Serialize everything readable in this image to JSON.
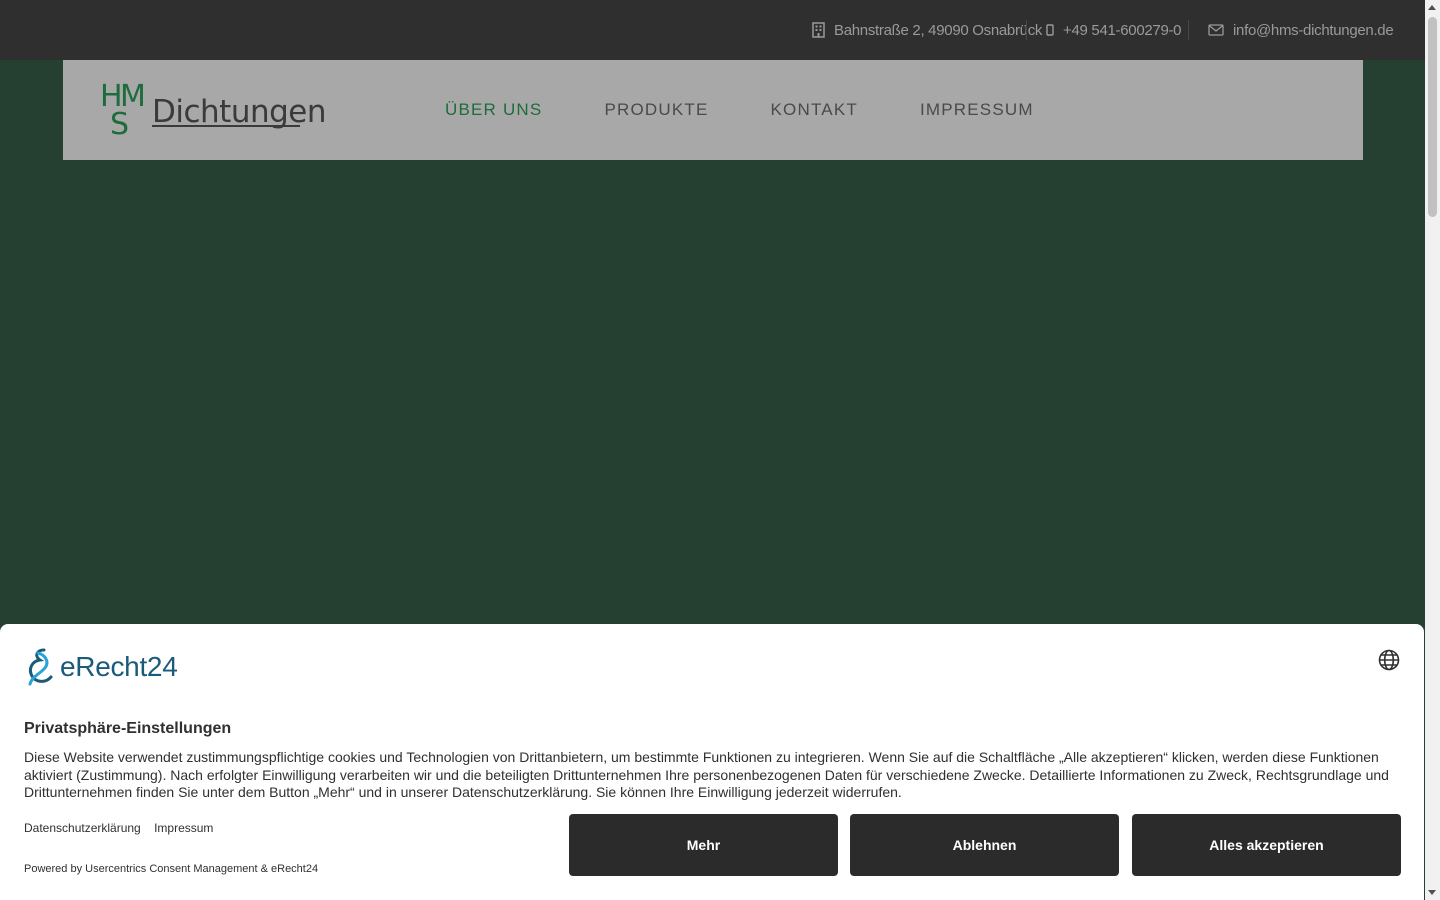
{
  "topbar": {
    "address": "Bahnstraße 2, 49090 Osnabrück",
    "phone": "+49 541-600279-0",
    "email": "info@hms-dichtungen.de"
  },
  "logo": {
    "letters": [
      "H",
      "M",
      "S"
    ],
    "word": "Dichtungen"
  },
  "nav": {
    "items": [
      "ÜBER UNS",
      "PRODUKTE",
      "KONTAKT",
      "IMPRESSUM"
    ],
    "active": "ÜBER UNS"
  },
  "consent": {
    "brand": "eRecht24",
    "title": "Privatsphäre-Einstellungen",
    "description": "Diese Website verwendet zustimmungspflichtige cookies und Technologien von Drittanbietern, um bestimmte Funktionen zu integrieren. Wenn Sie auf die Schaltfläche „Alle akzeptieren“ klicken, werden diese Funktionen aktiviert (Zustimmung). Nach erfolgter Einwilligung verarbeiten wir und die beteiligten Drittunternehmen Ihre personenbezogenen Daten für verschiedene Zwecke. Detaillierte Informationen zu Zweck, Rechtsgrundlage und Drittunternehmen finden Sie unter dem Button „Mehr“ und in unserer Datenschutzerklärung. Sie können Ihre Einwilligung jederzeit widerrufen.",
    "links": [
      "Datenschutzerklärung",
      "Impressum"
    ],
    "powered": "Powered by Usercentrics Consent Management & eRecht24",
    "buttons": {
      "more": "Mehr",
      "decline": "Ablehnen",
      "accept": "Alles akzeptieren"
    }
  },
  "colors": {
    "green_bg": "#254030",
    "accent": "#1f6b3d",
    "dark": "#2f2f2f"
  },
  "icons": [
    "building-icon",
    "phone-icon",
    "mail-icon",
    "globe-icon",
    "erecht24-logo-icon"
  ]
}
